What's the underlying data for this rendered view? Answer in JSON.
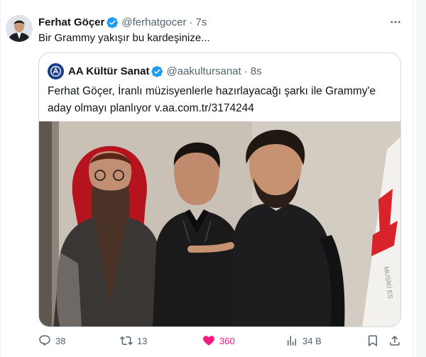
{
  "tweet": {
    "author_name": "Ferhat Göçer",
    "handle": "@ferhatgocer",
    "time": "7s",
    "text": "Bir Grammy yakışır bu kardeşinize...",
    "more_icon": "more-horizontal-icon"
  },
  "quote": {
    "author_name": "AA Kültür Sanat",
    "handle": "@aakultursanat",
    "time": "8s",
    "text": "Ferhat Göçer, İranlı müzisyenlerle hazırlayacağı şarkı ile Grammy'e aday olmayı planlıyor v.aa.com.tr/3174244",
    "banner_text": "MUSİKİ ES"
  },
  "actions": {
    "reply_count": "38",
    "retweet_count": "13",
    "like_count": "360",
    "views_count": "34 B"
  },
  "colors": {
    "verified": "#1d9bf0",
    "like": "#f91880",
    "muted": "#536471",
    "border": "#cfd9de"
  }
}
